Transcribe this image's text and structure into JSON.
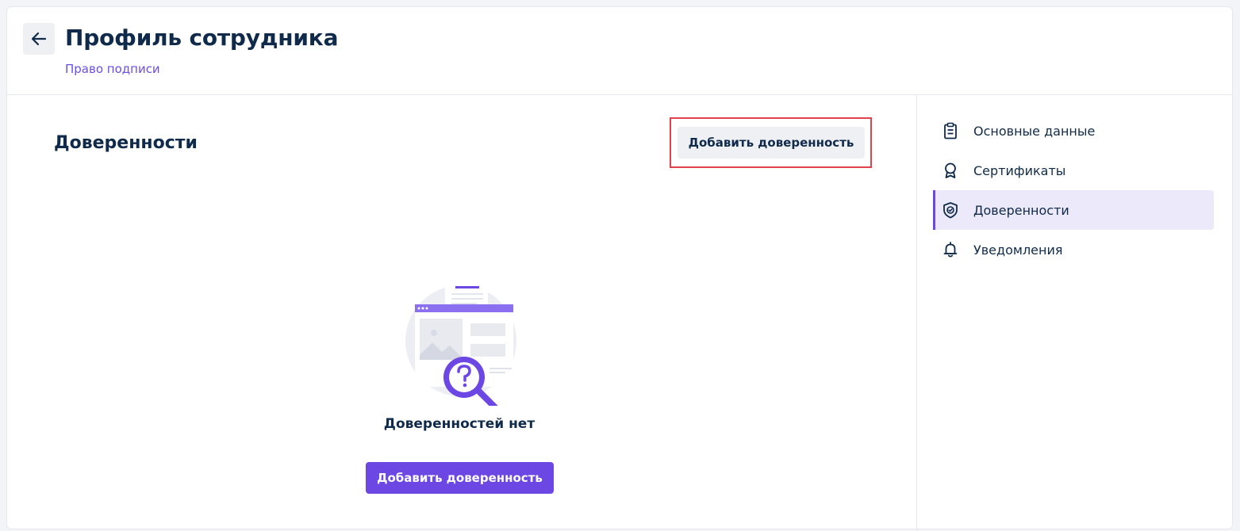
{
  "header": {
    "title": "Профиль сотрудника",
    "subtitle": "Право подписи"
  },
  "main": {
    "section_title": "Доверенности",
    "add_button_label": "Добавить доверенность",
    "empty_state": {
      "icon": "search-document-illustration",
      "message": "Доверенностей нет",
      "button_label": "Добавить доверенность"
    }
  },
  "sidebar": {
    "items": [
      {
        "label": "Основные данные",
        "icon": "clipboard-icon",
        "active": false
      },
      {
        "label": "Сертификаты",
        "icon": "award-icon",
        "active": false
      },
      {
        "label": "Доверенности",
        "icon": "shield-check-icon",
        "active": true
      },
      {
        "label": "Уведомления",
        "icon": "bell-icon",
        "active": false
      }
    ]
  },
  "colors": {
    "accent": "#6c47e4",
    "text": "#0f2a4a",
    "highlight": "#e0434b",
    "active_bg": "#ece9fb"
  }
}
